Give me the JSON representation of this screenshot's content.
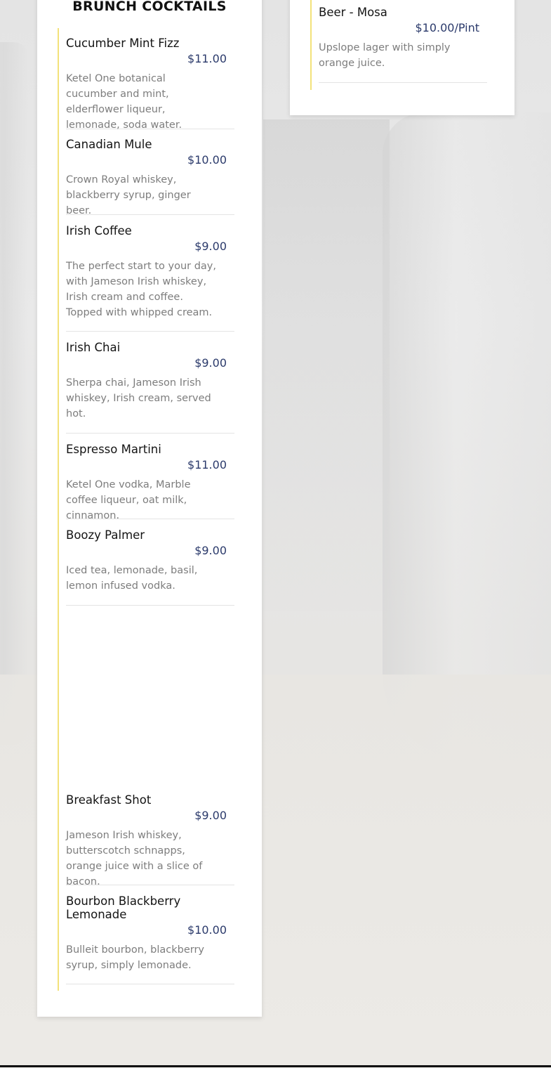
{
  "left_section": {
    "title": "BRUNCH COCKTAILS",
    "items": [
      {
        "name": "Cucumber Mint Fizz",
        "price": "$11.00",
        "desc": "Ketel One botanical cucumber and mint, elderflower liqueur, lemonade, soda water."
      },
      {
        "name": "Canadian Mule",
        "price": "$10.00",
        "desc": "Crown Royal whiskey, blackberry syrup, ginger beer."
      },
      {
        "name": "Irish Coffee",
        "price": "$9.00",
        "desc": "The perfect start to your day, with Jameson Irish whiskey, Irish cream and coffee. Topped with whipped cream."
      },
      {
        "name": "Irish Chai",
        "price": "$9.00",
        "desc": "Sherpa chai, Jameson Irish whiskey, Irish cream, served hot."
      },
      {
        "name": "Espresso Martini",
        "price": "$11.00",
        "desc": "Ketel One vodka, Marble coffee liqueur, oat milk, cinnamon."
      },
      {
        "name": "Boozy Palmer",
        "price": "$9.00",
        "desc": "Iced tea, lemonade, basil, lemon infused vodka."
      },
      {
        "name": "Breakfast Shot",
        "price": "$9.00",
        "desc": "Jameson Irish whiskey, butterscotch schnapps, orange juice with a slice of bacon."
      },
      {
        "name": "Bourbon Blackberry Lemonade",
        "price": "$10.00",
        "desc": "Bulleit bourbon, blackberry syrup, simply lemonade."
      }
    ]
  },
  "right_section": {
    "items": [
      {
        "name": "Beer - Mosa",
        "price": "$10.00/Pint",
        "desc": "Upslope lager with simply orange juice."
      }
    ]
  },
  "colors": {
    "accent_rule": "#f3e27a",
    "price_text": "#2b3a6b",
    "description_text": "#7d7d7d"
  }
}
